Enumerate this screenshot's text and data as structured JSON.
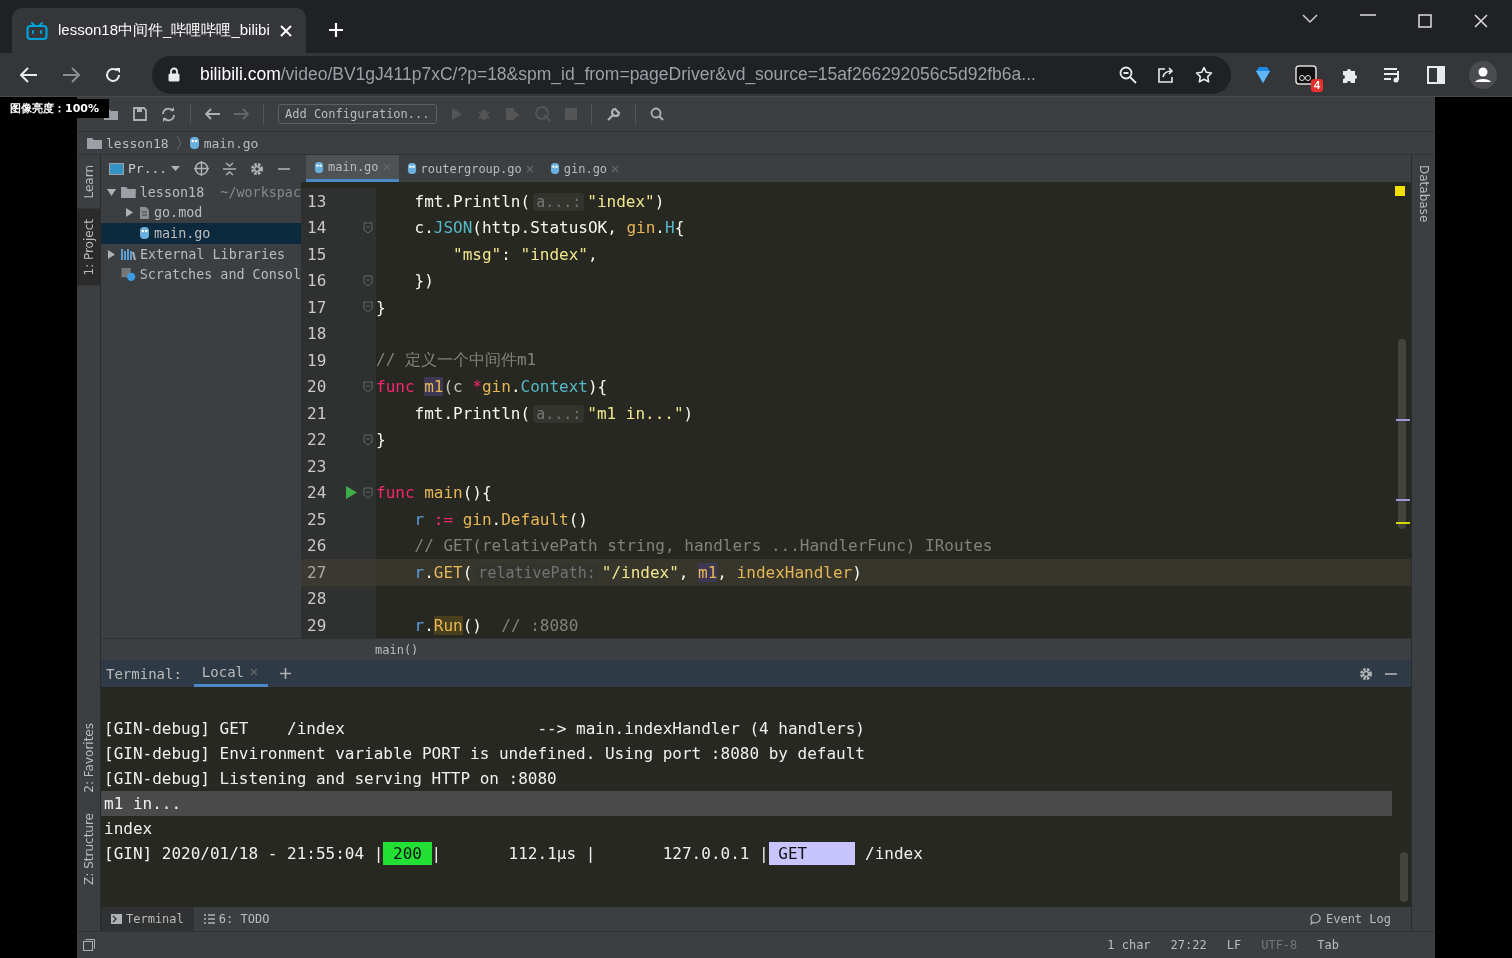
{
  "browser": {
    "tab": {
      "title": "lesson18中间件_哔哩哔哩_bilibi"
    },
    "url": {
      "host": "bilibili.com",
      "path": "/video/BV1gJ411p7xC/?p=18&spm_id_from=pageDriver&vd_source=15af266292056c5d92fb6a..."
    },
    "extension_badge": "4"
  },
  "overlay": "图像亮度：100%",
  "ide": {
    "toolbar": {
      "run_config": "Add Configuration..."
    },
    "breadcrumbs": [
      "lesson18",
      "main.go"
    ],
    "left_tools": [
      {
        "label": "Learn",
        "selected": false
      },
      {
        "label": "1: Project",
        "selected": true
      }
    ],
    "left_tools_bottom": [
      {
        "label": "2: Favorites",
        "selected": false
      },
      {
        "label": "Z: Structure",
        "selected": false
      }
    ],
    "right_tools": [
      {
        "label": "Database",
        "selected": false
      }
    ],
    "project": {
      "title": "Pr...",
      "tree": [
        {
          "label": "lesson18",
          "note": "~/workspac",
          "kind": "folder",
          "expanded": true,
          "selected": false,
          "children": [
            {
              "label": "go.mod",
              "kind": "file",
              "expanded": false,
              "selected": false
            },
            {
              "label": "main.go",
              "kind": "gofile",
              "selected": true
            }
          ]
        },
        {
          "label": "External Libraries",
          "kind": "library",
          "expanded": false,
          "selected": false
        },
        {
          "label": "Scratches and Consol",
          "kind": "scratch",
          "selected": false
        }
      ]
    },
    "editor_tabs": [
      {
        "label": "main.go",
        "selected": true
      },
      {
        "label": "routergroup.go",
        "selected": false
      },
      {
        "label": "gin.go",
        "selected": false
      }
    ],
    "code": [
      {
        "n": "13",
        "fold": false,
        "run": false,
        "current": false,
        "tokens": [
          {
            "t": "    fmt.Println(",
            "kind": "plain"
          },
          {
            "t": "a...:",
            "kind": "hint"
          },
          {
            "t": "\"index\"",
            "kind": "str"
          },
          {
            "t": ")",
            "kind": "plain"
          }
        ]
      },
      {
        "n": "14",
        "fold": true,
        "run": false,
        "current": false,
        "tokens": [
          {
            "t": "    c.",
            "kind": "plain"
          },
          {
            "t": "JSON",
            "kind": "type"
          },
          {
            "t": "(http.StatusOK, ",
            "kind": "plain"
          },
          {
            "t": "gin",
            "kind": "fn"
          },
          {
            "t": ".",
            "kind": "plain"
          },
          {
            "t": "H",
            "kind": "type"
          },
          {
            "t": "{",
            "kind": "plain"
          }
        ]
      },
      {
        "n": "15",
        "fold": false,
        "run": false,
        "current": false,
        "tokens": [
          {
            "t": "        \"msg\"",
            "kind": "str"
          },
          {
            "t": ": ",
            "kind": "plain"
          },
          {
            "t": "\"index\"",
            "kind": "str"
          },
          {
            "t": ",",
            "kind": "plain"
          }
        ]
      },
      {
        "n": "16",
        "fold": true,
        "run": false,
        "current": false,
        "tokens": [
          {
            "t": "    })",
            "kind": "plain"
          }
        ]
      },
      {
        "n": "17",
        "fold": true,
        "run": false,
        "current": false,
        "tokens": [
          {
            "t": "}",
            "kind": "plain"
          }
        ]
      },
      {
        "n": "18",
        "fold": false,
        "run": false,
        "current": false
      },
      {
        "n": "19",
        "fold": false,
        "run": false,
        "current": false,
        "tokens": [
          {
            "t": "// 定义一个中间件m1",
            "kind": "cm"
          }
        ]
      },
      {
        "n": "20",
        "fold": true,
        "run": false,
        "current": false,
        "tokens": [
          {
            "t": "func ",
            "kind": "kw"
          },
          {
            "t": "m1",
            "kind": "fn",
            "highlighted": true
          },
          {
            "t": "(c ",
            "kind": "param"
          },
          {
            "t": "*",
            "kind": "op"
          },
          {
            "t": "gin",
            "kind": "fn"
          },
          {
            "t": ".",
            "kind": "plain"
          },
          {
            "t": "Context",
            "kind": "type"
          },
          {
            "t": "){",
            "kind": "plain"
          }
        ]
      },
      {
        "n": "21",
        "fold": false,
        "run": false,
        "current": false,
        "tokens": [
          {
            "t": "    fmt.Println(",
            "kind": "plain"
          },
          {
            "t": "a...:",
            "kind": "hint"
          },
          {
            "t": "\"m1 in...\"",
            "kind": "str"
          },
          {
            "t": ")",
            "kind": "plain"
          }
        ]
      },
      {
        "n": "22",
        "fold": true,
        "run": false,
        "current": false,
        "tokens": [
          {
            "t": "}",
            "kind": "plain"
          }
        ]
      },
      {
        "n": "23",
        "fold": false,
        "run": false,
        "current": false
      },
      {
        "n": "24",
        "fold": true,
        "run": true,
        "current": false,
        "tokens": [
          {
            "t": "func ",
            "kind": "kw"
          },
          {
            "t": "main",
            "kind": "fn"
          },
          {
            "t": "(){",
            "kind": "plain"
          }
        ]
      },
      {
        "n": "25",
        "fold": false,
        "run": false,
        "current": false,
        "tokens": [
          {
            "t": "    r ",
            "kind": "var"
          },
          {
            "t": ":=",
            "kind": "op"
          },
          {
            "t": " gin",
            "kind": "fn"
          },
          {
            "t": ".",
            "kind": "plain"
          },
          {
            "t": "Default",
            "kind": "fn"
          },
          {
            "t": "()",
            "kind": "plain"
          }
        ]
      },
      {
        "n": "26",
        "fold": false,
        "run": false,
        "current": false,
        "tokens": [
          {
            "t": "    // GET(relativePath string, handlers ...HandlerFunc) IRoutes",
            "kind": "cm"
          }
        ]
      },
      {
        "n": "27",
        "fold": false,
        "run": false,
        "current": true,
        "tokens": [
          {
            "t": "    r",
            "kind": "var"
          },
          {
            "t": ".",
            "kind": "plain"
          },
          {
            "t": "GET",
            "kind": "fn"
          },
          {
            "t": "(",
            "kind": "plain"
          },
          {
            "t": "relativePath:",
            "kind": "hint"
          },
          {
            "t": "\"/index\"",
            "kind": "str"
          },
          {
            "t": ", ",
            "kind": "plain"
          },
          {
            "t": "m1",
            "kind": "fn",
            "highlighted": true
          },
          {
            "t": ", ",
            "kind": "plain"
          },
          {
            "t": "indexHandler",
            "kind": "fn"
          },
          {
            "t": ")",
            "kind": "plain"
          }
        ]
      },
      {
        "n": "28",
        "fold": false,
        "run": false,
        "current": false
      },
      {
        "n": "29",
        "fold": false,
        "run": false,
        "current": false,
        "tokens": [
          {
            "t": "    r",
            "kind": "var"
          },
          {
            "t": ".",
            "kind": "plain"
          },
          {
            "t": "Run",
            "kind": "fn",
            "warning": true
          },
          {
            "t": "()  ",
            "kind": "plain"
          },
          {
            "t": "// :8080",
            "kind": "cm"
          }
        ]
      }
    ],
    "code_breadcrumb": "main()",
    "terminal": {
      "title": "Terminal:",
      "tabs": [
        {
          "label": "Local",
          "selected": true
        }
      ],
      "lines": [
        {
          "selected": false,
          "segments": [
            {
              "kind": "text",
              "text": "[GIN-debug] GET    /index                    --> main.indexHandler (4 handlers)"
            }
          ]
        },
        {
          "selected": false,
          "segments": [
            {
              "kind": "text",
              "text": "[GIN-debug] Environment variable PORT is undefined. Using port :8080 by default"
            }
          ]
        },
        {
          "selected": false,
          "segments": [
            {
              "kind": "text",
              "text": "[GIN-debug] Listening and serving HTTP on :8080"
            }
          ]
        },
        {
          "selected": true,
          "segments": [
            {
              "kind": "text",
              "text": "m1 in..."
            }
          ]
        },
        {
          "selected": false,
          "segments": [
            {
              "kind": "text",
              "text": "index"
            }
          ]
        },
        {
          "selected": false,
          "segments": [
            {
              "kind": "text",
              "text": "[GIN] 2020/01/18 - 21:55:04 |"
            },
            {
              "kind": "badge",
              "text": " 200 ",
              "color": "#22e034"
            },
            {
              "kind": "text",
              "text": "|       112.1µs |       127.0.0.1 |"
            },
            {
              "kind": "badge",
              "text": " GET     ",
              "color": "#c8c4ff"
            },
            {
              "kind": "text",
              "text": " /index"
            }
          ]
        }
      ]
    },
    "bottom_tools": [
      {
        "label": "Terminal",
        "selected": true
      },
      {
        "label": "6: TODO",
        "selected": false
      }
    ],
    "event_log": "Event Log",
    "status": [
      {
        "text": "1 char",
        "disabled": false
      },
      {
        "text": "27:22",
        "disabled": false
      },
      {
        "text": "LF",
        "disabled": false
      },
      {
        "text": "UTF-8",
        "disabled": true
      },
      {
        "text": "Tab",
        "disabled": false
      }
    ]
  }
}
